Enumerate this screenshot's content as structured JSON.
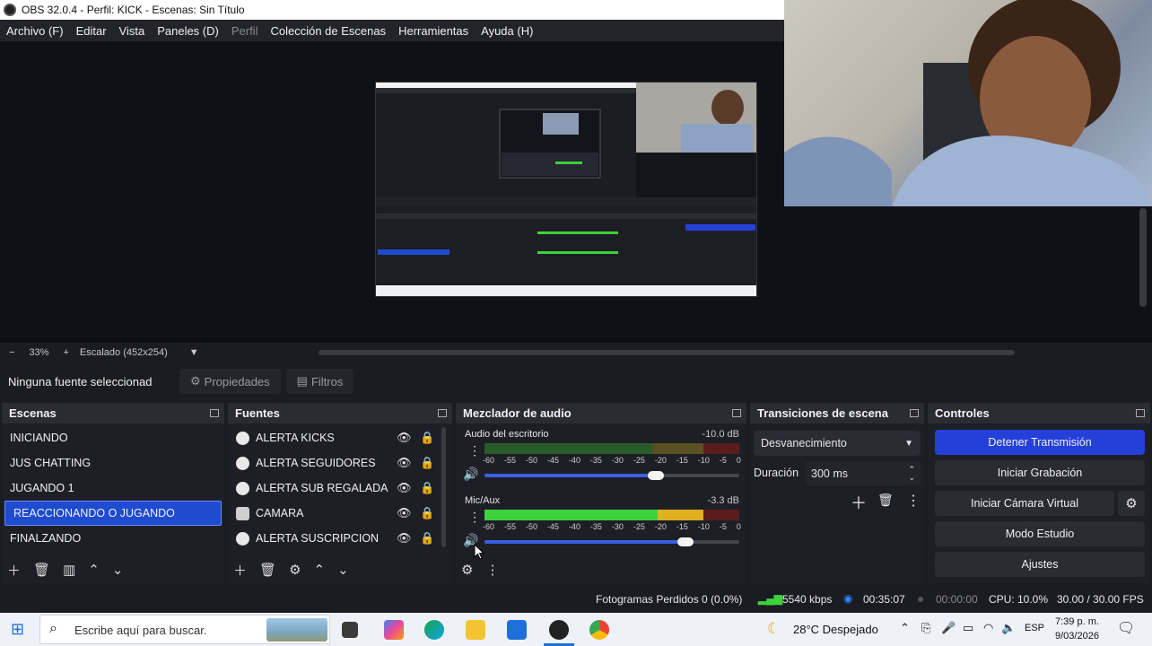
{
  "window": {
    "title": "OBS 32.0.4 - Perfil: KICK - Escenas: Sin Título"
  },
  "menu": [
    {
      "label": "Archivo (F)",
      "enabled": true
    },
    {
      "label": "Editar",
      "enabled": true
    },
    {
      "label": "Vista",
      "enabled": true
    },
    {
      "label": "Paneles (D)",
      "enabled": true
    },
    {
      "label": "Perfil",
      "enabled": false
    },
    {
      "label": "Colección de Escenas",
      "enabled": true
    },
    {
      "label": "Herramientas",
      "enabled": true
    },
    {
      "label": "Ayuda (H)",
      "enabled": true
    }
  ],
  "zoom": {
    "minus": "−",
    "value": "33%",
    "plus": "+",
    "scale_label": "Escalado (452x254)"
  },
  "source_bar": {
    "no_source": "Ninguna fuente seleccionad",
    "properties": "Propiedades",
    "filters": "Filtros"
  },
  "scenes": {
    "title": "Escenas",
    "items": [
      "INICIANDO",
      "JUS CHATTING",
      "JUGANDO 1",
      "REACCIONANDO O JUGANDO",
      "FINALZANDO"
    ],
    "selected_index": 3
  },
  "sources": {
    "title": "Fuentes",
    "items": [
      {
        "label": "ALERTA KICKS",
        "icon": "browser-icon"
      },
      {
        "label": "ALERTA SEGUIDORES",
        "icon": "browser-icon"
      },
      {
        "label": "ALERTA SUB REGALADA",
        "icon": "browser-icon"
      },
      {
        "label": "CAMARA",
        "icon": "camera-icon"
      },
      {
        "label": "ALERTA SUSCRIPCION",
        "icon": "browser-icon"
      }
    ]
  },
  "mixer": {
    "title": "Mezclador de audio",
    "ticks": [
      "-60",
      "-55",
      "-50",
      "-45",
      "-40",
      "-35",
      "-30",
      "-25",
      "-20",
      "-15",
      "-10",
      "-5",
      "0"
    ],
    "channels": [
      {
        "name": "Audio del escritorio",
        "db": "-10.0 dB",
        "volume": 0.82,
        "level": 0.0
      },
      {
        "name": "Mic/Aux",
        "db": "-3.3 dB",
        "volume": 0.96,
        "level": 0.86
      }
    ]
  },
  "transitions": {
    "title": "Transiciones de escena",
    "selected": "Desvanecimiento",
    "duration_label": "Duración",
    "duration_value": "300 ms"
  },
  "controls": {
    "title": "Controles",
    "stop_stream": "Detener Transmisión",
    "start_record": "Iniciar Grabación",
    "virtual_cam": "Iniciar Cámara Virtual",
    "studio_mode": "Modo Estudio",
    "settings": "Ajustes"
  },
  "status": {
    "dropped": "Fotogramas Perdidos 0 (0.0%)",
    "bitrate": "5540 kbps",
    "stream_time": "00:35:07",
    "record_time": "00:00:00",
    "cpu": "CPU: 10.0%",
    "fps": "30.00 / 30.00 FPS"
  },
  "taskbar": {
    "search_placeholder": "Escribe aquí para buscar.",
    "weather": "28°C  Despejado",
    "lang": "ESP",
    "time": "7:39 p. m.",
    "date": "9/03/2026"
  },
  "colors": {
    "accent": "#2540d9",
    "selected_scene": "#1f4bcf",
    "meter_green": "#3bd23b",
    "meter_yellow": "#e0b020",
    "meter_red": "#c0242c"
  }
}
